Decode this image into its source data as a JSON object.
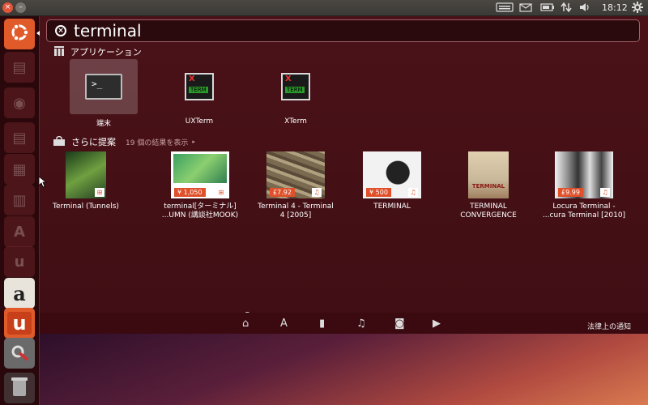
{
  "panel": {
    "clock": "18:12",
    "close_glyph": "×",
    "min_glyph": "–"
  },
  "launcher": {
    "items": [
      {
        "name": "dash-home",
        "icon": "ubuntu-logo-icon"
      },
      {
        "name": "files",
        "icon": "folder-icon"
      },
      {
        "name": "firefox",
        "icon": "firefox-icon"
      },
      {
        "name": "writer",
        "icon": "document-icon"
      },
      {
        "name": "calc",
        "icon": "spreadsheet-icon"
      },
      {
        "name": "impress",
        "icon": "presentation-icon"
      },
      {
        "name": "software-center",
        "icon": "software-center-icon"
      },
      {
        "name": "ubuntu-one",
        "icon": "ubuntu-one-icon"
      },
      {
        "name": "amazon",
        "icon": "amazon-icon"
      },
      {
        "name": "ubuntu-one-music",
        "icon": "ubuntu-one-icon"
      },
      {
        "name": "system-settings",
        "icon": "settings-icon"
      },
      {
        "name": "trash",
        "icon": "trash-icon"
      }
    ],
    "dim_glyphs": [
      "▤",
      "◉",
      "▤",
      "▦",
      "▥",
      "A",
      "u"
    ],
    "amazon_letter": "a",
    "u1_letter": "u"
  },
  "search": {
    "query": "terminal"
  },
  "applications": {
    "heading": "アプリケーション",
    "items": [
      {
        "label": "端末",
        "icon": "terminal-icon"
      },
      {
        "label": "UXTerm",
        "icon": "xterm-icon"
      },
      {
        "label": "XTerm",
        "icon": "xterm-icon"
      }
    ],
    "xterm_badge": "X",
    "xterm_text": "TERM",
    "terminal_prompt": ">_"
  },
  "suggestions": {
    "heading": "さらに提案",
    "more_results": "19 個の結果を表示",
    "items": [
      {
        "line1": "Terminal (Tunnels)",
        "line2": "",
        "price": ""
      },
      {
        "line1": "terminal[ターミナル]",
        "line2": "...UMN (講談社MOOK)",
        "price": "¥ 1,050"
      },
      {
        "line1": "Terminal 4 - Terminal",
        "line2": "4 [2005]",
        "price": "£7.92"
      },
      {
        "line1": "TERMINAL",
        "line2": "",
        "price": "¥ 500"
      },
      {
        "line1": "TERMINAL",
        "line2": "CONVERGENCE",
        "price": ""
      },
      {
        "line1": "Locura Terminal -",
        "line2": "...cura Terminal [2010]",
        "price": "£9.99"
      }
    ],
    "covers": [
      {
        "colors": [
          "#1a3a1a",
          "#6fa040",
          "#244024"
        ]
      },
      {
        "colors": [
          "#3aa060",
          "#8ccf70",
          "#2f7f50"
        ]
      },
      {
        "colors": [
          "#7a6a50",
          "#b0a080",
          "#5a4a38"
        ]
      },
      {
        "colors": [
          "#d8d8d8",
          "#f4f4f4",
          "#222"
        ]
      },
      {
        "colors": [
          "#c9b89a",
          "#e0d0b0",
          "#a08060"
        ]
      },
      {
        "colors": [
          "#ddd",
          "#f2f2f2",
          "#333"
        ]
      }
    ],
    "cover_text_5": "TERMINAL"
  },
  "filters": {
    "legal": "法律上の通知"
  },
  "colors": {
    "accent": "#e0502a",
    "launcher_bg": "#28060a",
    "dash_bg": "#4a1218"
  }
}
